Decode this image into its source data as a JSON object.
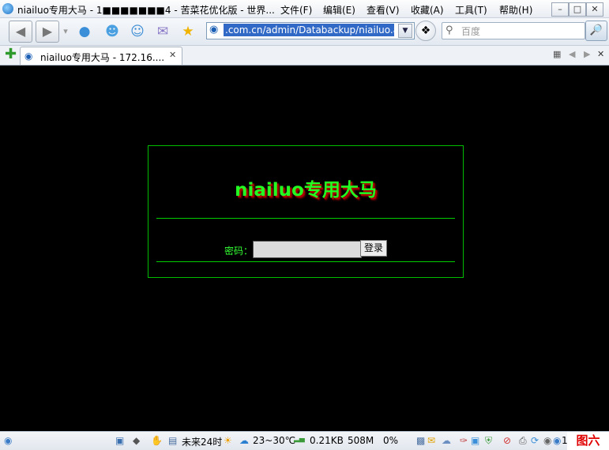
{
  "window": {
    "title": "niailuo专用大马 - 1■■■■■■■4 - 苦菜花优化版 - 世界...",
    "menus": [
      "文件(F)",
      "编辑(E)",
      "查看(V)",
      "收藏(A)",
      "工具(T)",
      "帮助(H)"
    ],
    "controls": {
      "minimize": "–",
      "maximize": "□",
      "close": "✕"
    }
  },
  "toolbar": {
    "back": "◀",
    "forward": "▶",
    "address": ".com.cn/admin/Databackup/niailuo.asp",
    "address_dropdown": "▼",
    "search_placeholder": "百度",
    "search_go": "🔎"
  },
  "tabs": {
    "new_tab": "✚",
    "items": [
      {
        "label": "niailuo专用大马 - 172.16....",
        "close": "✕"
      }
    ],
    "nav_close": "✕"
  },
  "login": {
    "title": "niailuo专用大马",
    "password_label": "密码：",
    "password_value": "",
    "submit": "登录"
  },
  "status": {
    "weather_text": "未来24时",
    "temperature": "23~30℃",
    "speed": "0.21KB",
    "memory": "508M",
    "cpu": "0%",
    "count": "1",
    "corner_label": "图六"
  },
  "colors": {
    "page_background": "#000000",
    "border_green": "#00bb00",
    "title_green": "#22ff22",
    "title_shadow": "#aa0000",
    "label_green": "#33ff33",
    "corner_red": "#e00000"
  }
}
